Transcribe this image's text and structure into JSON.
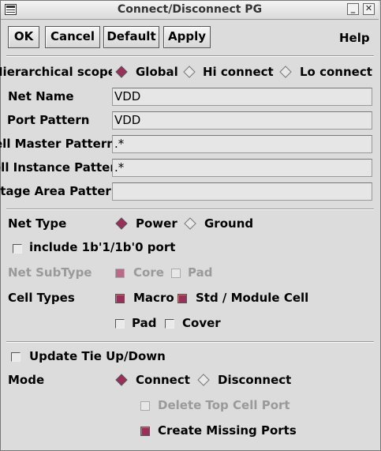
{
  "window": {
    "title": "Connect/Disconnect PG"
  },
  "toolbar": {
    "ok": "OK",
    "cancel": "Cancel",
    "default": "Default",
    "apply": "Apply",
    "help": "Help"
  },
  "scope": {
    "label": "Hierarchical scope",
    "options": [
      "Global",
      "Hi connect",
      "Lo connect"
    ],
    "selected": "Global"
  },
  "fields": {
    "net_name": {
      "label": "Net Name",
      "value": "VDD"
    },
    "port_pattern": {
      "label": "Port Pattern",
      "value": "VDD"
    },
    "cell_master_pattern": {
      "label": "Cell Master Pattern",
      "value": ".*"
    },
    "cell_instance_pattern": {
      "label": "Cell Instance Pattern",
      "value": ".*"
    },
    "voltage_area_pattern": {
      "label": "Voltage Area Pattern",
      "value": ""
    }
  },
  "net_type": {
    "label": "Net Type",
    "options": [
      "Power",
      "Ground"
    ],
    "selected": "Power"
  },
  "include_port": {
    "label": "include 1b'1/1b'0 port",
    "checked": false
  },
  "net_subtype": {
    "label": "Net SubType",
    "core": "Core",
    "core_checked": true,
    "pad": "Pad",
    "pad_checked": false,
    "enabled": false
  },
  "cell_types": {
    "label": "Cell Types",
    "macro": "Macro",
    "std": "Std / Module Cell",
    "pad": "Pad",
    "cover": "Cover"
  },
  "tie": {
    "label": "Update Tie Up/Down",
    "checked": false
  },
  "mode": {
    "label": "Mode",
    "options": [
      "Connect",
      "Disconnect"
    ],
    "selected": "Connect"
  },
  "delete_top": {
    "label": "Delete Top Cell Port",
    "checked": false,
    "enabled": false
  },
  "create_missing": {
    "label": "Create Missing Ports",
    "checked": true
  },
  "colors": {
    "accent": "#9a2f5a",
    "background": "#dcdcdc",
    "disabled_text": "#9a9a9a"
  }
}
